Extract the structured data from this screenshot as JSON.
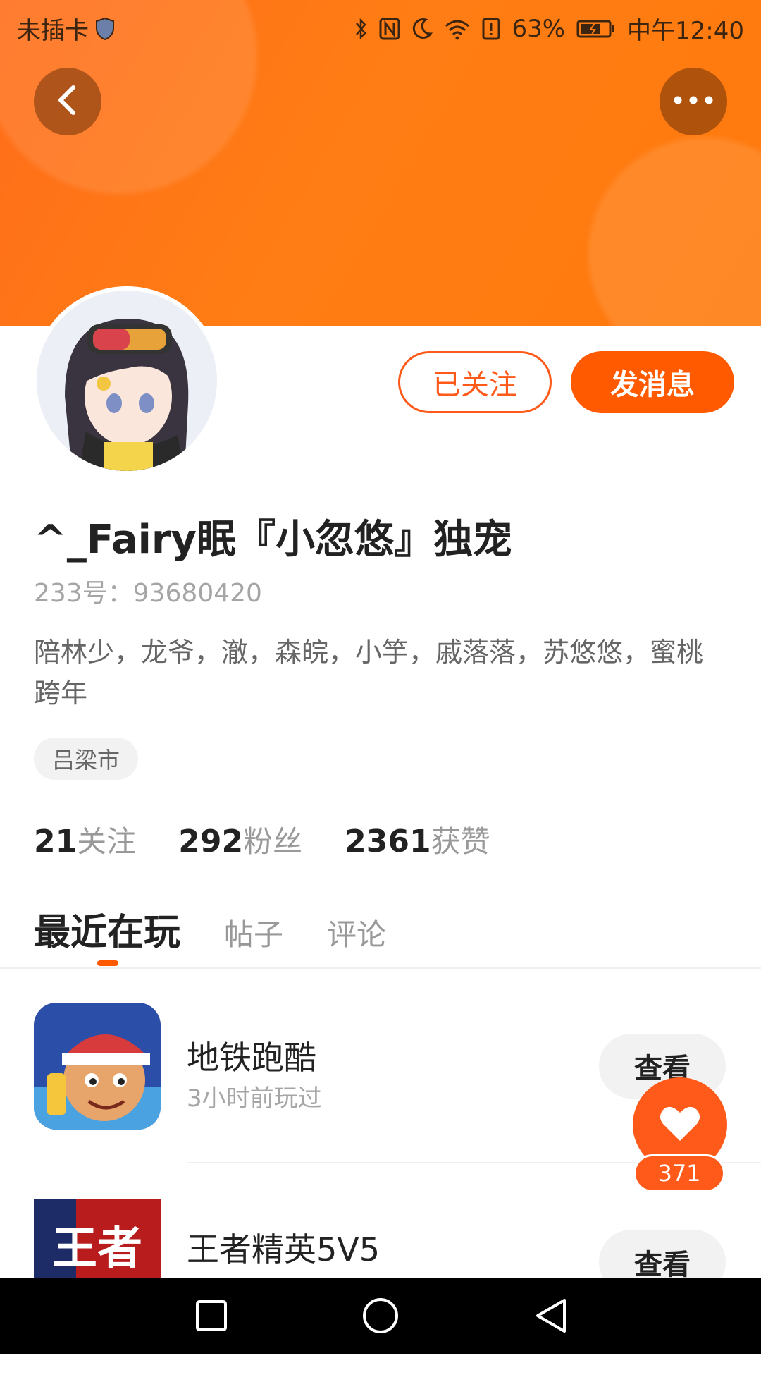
{
  "status_bar": {
    "carrier": "未插卡",
    "battery": "63%",
    "time": "中午12:40",
    "icons": [
      "shield-icon",
      "bluetooth-icon",
      "nfc-icon",
      "moon-icon",
      "wifi-icon",
      "alert-icon",
      "battery-icon"
    ]
  },
  "header": {
    "back_icon": "chevron-left-icon",
    "more_icon": "more-dots-icon"
  },
  "profile": {
    "follow_label": "已关注",
    "message_label": "发消息",
    "nickname": "^_Fairy眠『小忽悠』独宠",
    "user_id": "233号：93680420",
    "bio": "陪林少，龙爷，澈，森皖，小竽，戚落落，苏悠悠，蜜桃跨年",
    "location": "吕梁市"
  },
  "stats": [
    {
      "number": "21",
      "label": "关注"
    },
    {
      "number": "292",
      "label": "粉丝"
    },
    {
      "number": "2361",
      "label": "获赞"
    }
  ],
  "tabs": [
    {
      "label": "最近在玩",
      "active": true
    },
    {
      "label": "帖子",
      "active": false
    },
    {
      "label": "评论",
      "active": false
    }
  ],
  "games": [
    {
      "name": "地铁跑酷",
      "sub": "3小时前玩过",
      "button": "查看",
      "icon": "subway-surfers-icon"
    },
    {
      "name": "王者精英5V5",
      "sub": "",
      "button": "查看",
      "icon": "king-elite-icon"
    }
  ],
  "like": {
    "count": "371",
    "icon": "heart-icon"
  },
  "nav_bar": {
    "icons": [
      "square-icon",
      "circle-icon",
      "triangle-back-icon"
    ]
  },
  "colors": {
    "accent": "#ff5a00",
    "banner": "#ff7a14"
  }
}
